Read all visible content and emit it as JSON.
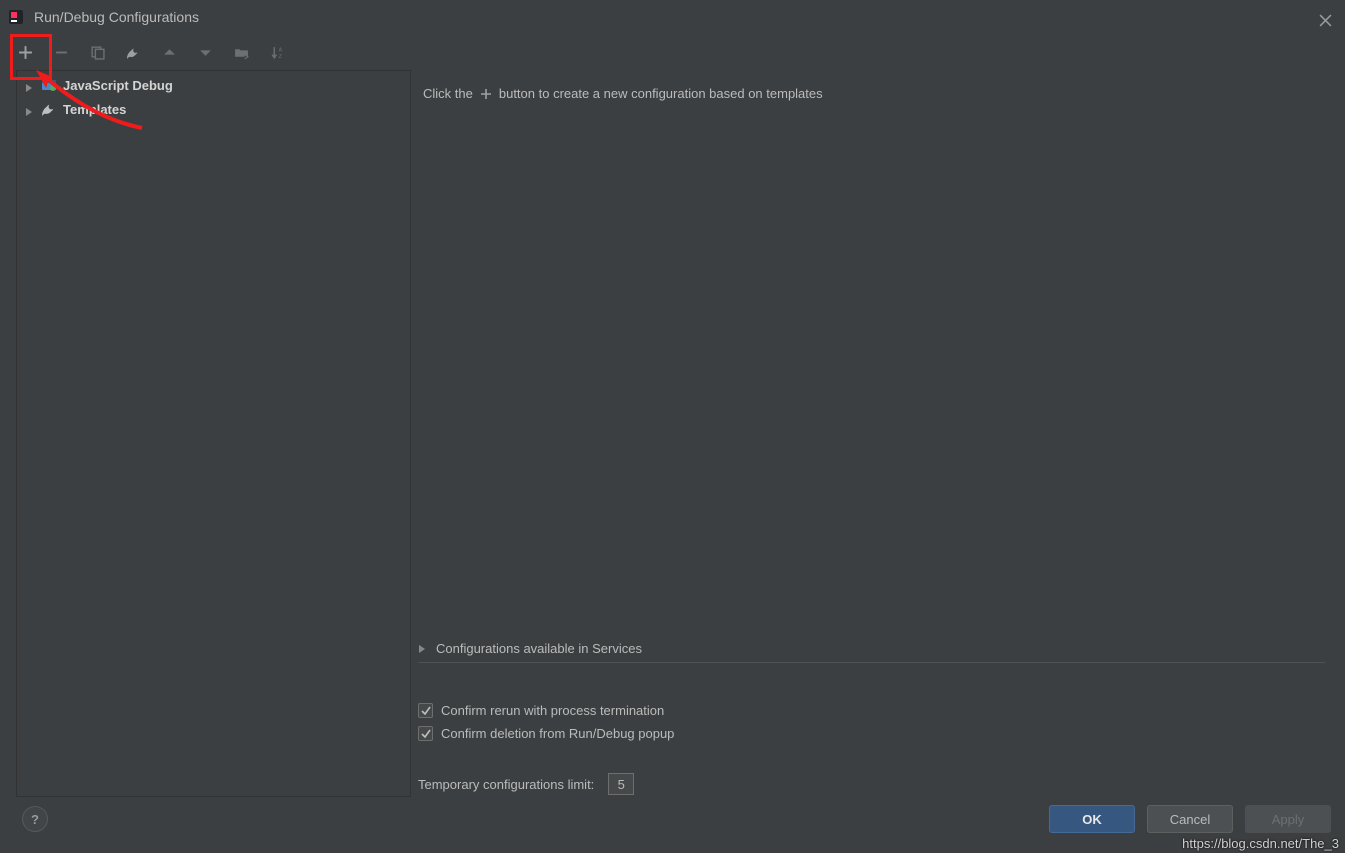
{
  "title": "Run/Debug Configurations",
  "toolbar": {
    "add_icon": "plus-icon",
    "remove_icon": "minus-icon",
    "copy_icon": "copy-icon",
    "edit_icon": "wrench-icon",
    "up_icon": "up-icon",
    "down_icon": "down-icon",
    "folder_icon": "folder-icon",
    "sort_icon": "sort-icon"
  },
  "tree": {
    "items": [
      {
        "label": "JavaScript Debug",
        "icon": "js-debug-icon"
      },
      {
        "label": "Templates",
        "icon": "wrench-icon"
      }
    ]
  },
  "right": {
    "hint_before": "Click the",
    "hint_after": "button to create a new configuration based on templates",
    "expander_label": "Configurations available in Services",
    "check1_label": "Confirm rerun with process termination",
    "check2_label": "Confirm deletion from Run/Debug popup",
    "limit_label": "Temporary configurations limit:",
    "limit_value": "5"
  },
  "buttons": {
    "ok": "OK",
    "cancel": "Cancel",
    "apply": "Apply",
    "help": "?"
  },
  "watermark": "https://blog.csdn.net/The_3"
}
